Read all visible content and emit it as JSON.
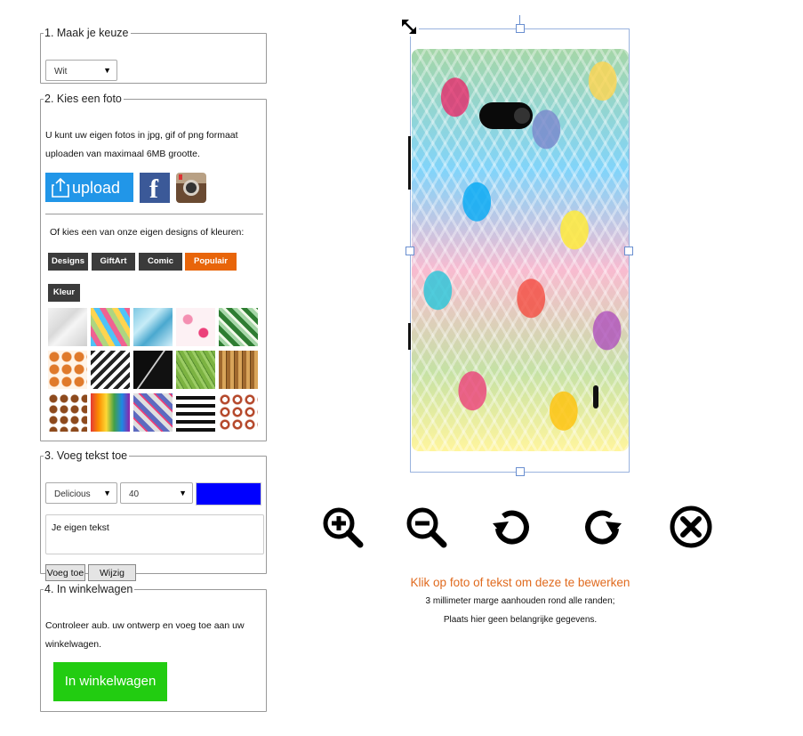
{
  "section1": {
    "legend": "1. Maak je keuze",
    "select_value": "Wit"
  },
  "section2": {
    "legend": "2. Kies een foto",
    "description": "U kunt uw eigen fotos in jpg, gif of png formaat uploaden van maximaal 6MB grootte.",
    "upload_label": "upload",
    "designs_intro": "Of kies een van onze eigen designs of kleuren:",
    "category_buttons": [
      "Designs",
      "GiftArt",
      "Comic",
      "Populair",
      "Kleur"
    ],
    "active_category": "Populair",
    "accent_color": "#e8650a"
  },
  "section3": {
    "legend": "3. Voeg tekst toe",
    "font_value": "Delicious",
    "size_value": "40",
    "text_color": "#0000ff",
    "textarea_value": "Je eigen tekst",
    "add_button": "Voeg toe",
    "edit_button": "Wijzig tekst"
  },
  "section4": {
    "legend": "4. In winkelwagen",
    "description": "Controleer aub. uw ontwerp en voeg toe aan uw winkelwagen.",
    "cart_button": "In winkelwagen",
    "cart_color": "#22cc11"
  },
  "preview": {
    "instruction": "Klik op foto of tekst om deze te bewerken",
    "instruction_color": "#e06a1e",
    "note_line1": "3 millimeter marge aanhouden rond alle randen;",
    "note_line2": "Plaats hier geen belangrijke gegevens."
  },
  "icons": [
    "resize-icon",
    "zoom-in-icon",
    "zoom-out-icon",
    "rotate-left-icon",
    "rotate-right-icon",
    "delete-icon",
    "facebook-icon",
    "instagram-icon",
    "upload-icon"
  ]
}
